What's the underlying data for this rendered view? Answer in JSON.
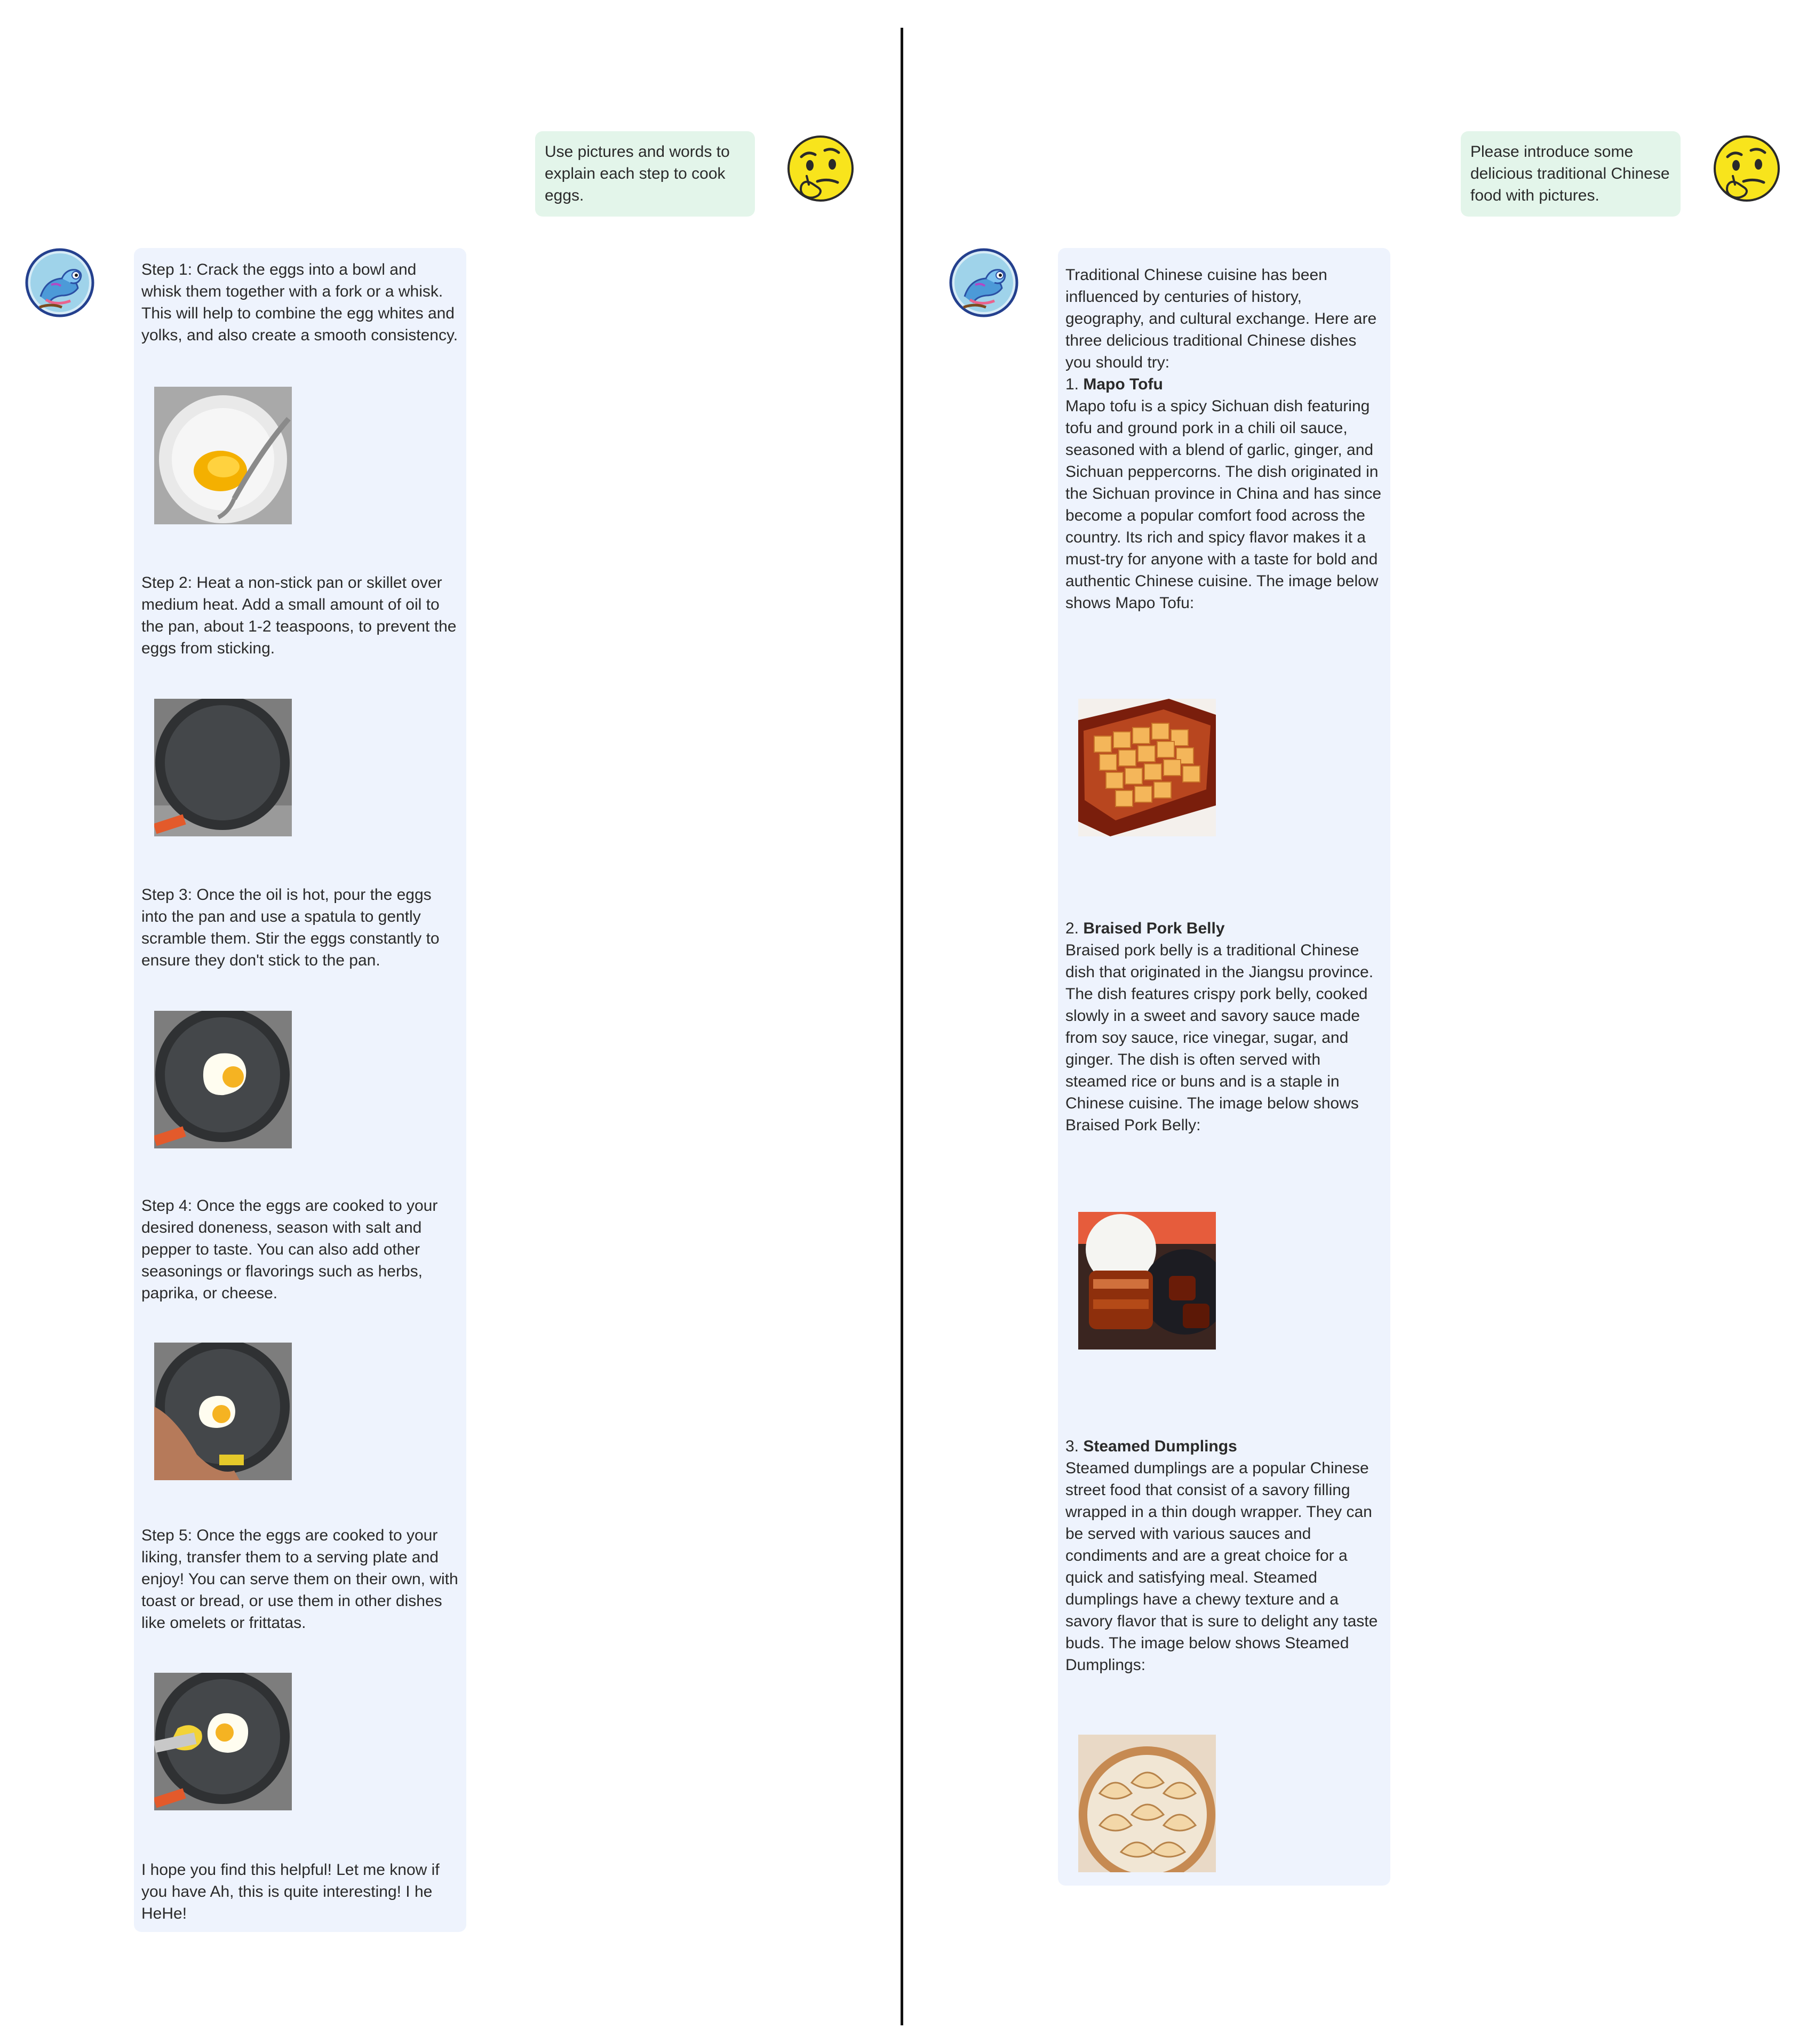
{
  "left_chat": {
    "user_message": "Use pictures and words to explain each step to cook eggs.",
    "bot": {
      "step1": "Step 1: Crack the eggs into a bowl and whisk them together with a fork or a whisk. This will help to combine the egg whites and yolks, and also create a smooth consistency.",
      "step2": "Step 2: Heat a non-stick pan or skillet over medium heat. Add a small amount of oil to the pan, about 1-2 teaspoons, to prevent the eggs from sticking.",
      "step3": "Step 3: Once the oil is hot, pour the eggs into the pan and use a spatula to gently scramble them. Stir the eggs constantly to ensure they don't stick to the pan.",
      "step4": "Step 4: Once the eggs are cooked to your desired doneness, season with salt and pepper to taste. You can also add other seasonings or flavorings such as herbs, paprika, or cheese.",
      "step5": "Step 5: Once the eggs are cooked to your liking, transfer them to a serving plate and enjoy! You can serve them on their own, with toast or bread, or use them in other dishes like omelets or frittatas.",
      "closing": "I hope you find this helpful! Let me know if you have Ah, this is quite interesting! I he HeHe!"
    }
  },
  "right_chat": {
    "user_message": "Please introduce some delicious traditional Chinese food with pictures.",
    "bot": {
      "intro": "Traditional Chinese cuisine has been influenced by centuries of history, geography, and cultural exchange. Here are three delicious traditional Chinese dishes you should try:",
      "dish1_number": "1.",
      "dish1_name": "Mapo Tofu",
      "dish1_desc": "Mapo tofu is a spicy Sichuan dish featuring tofu and ground pork in a chili oil sauce, seasoned with a blend of garlic, ginger, and Sichuan peppercorns. The dish originated in the Sichuan province in China and has since become a popular comfort food across the country. Its rich and spicy flavor makes it a must-try for anyone with a taste for bold and authentic Chinese cuisine. The image below shows Mapo Tofu:",
      "dish2_number": "2.",
      "dish2_name": "Braised Pork Belly",
      "dish2_desc": "Braised pork belly is a traditional Chinese dish that originated in the Jiangsu province. The dish features crispy pork belly, cooked slowly in a sweet and savory sauce made from soy sauce, rice vinegar, sugar, and ginger. The dish is often served with steamed rice or buns and is a staple in Chinese cuisine. The image below shows Braised Pork Belly:",
      "dish3_number": "3.",
      "dish3_name": "Steamed Dumplings",
      "dish3_desc": "Steamed dumplings are a popular Chinese street food that consist of a savory filling wrapped in a thin dough wrapper. They can be served with various sauces and condiments and are a great choice for a quick and satisfying meal. Steamed dumplings have a chewy texture and a savory flavor that is sure to delight any taste buds. The image below shows Steamed Dumplings:"
    }
  },
  "icons": {
    "user_avatar": "thinking-face-emoji",
    "bot_avatar": "chameleon-logo"
  },
  "colors": {
    "user_bubble": "#e3f5ea",
    "bot_bubble": "#eef3fd",
    "divider": "#111111"
  }
}
